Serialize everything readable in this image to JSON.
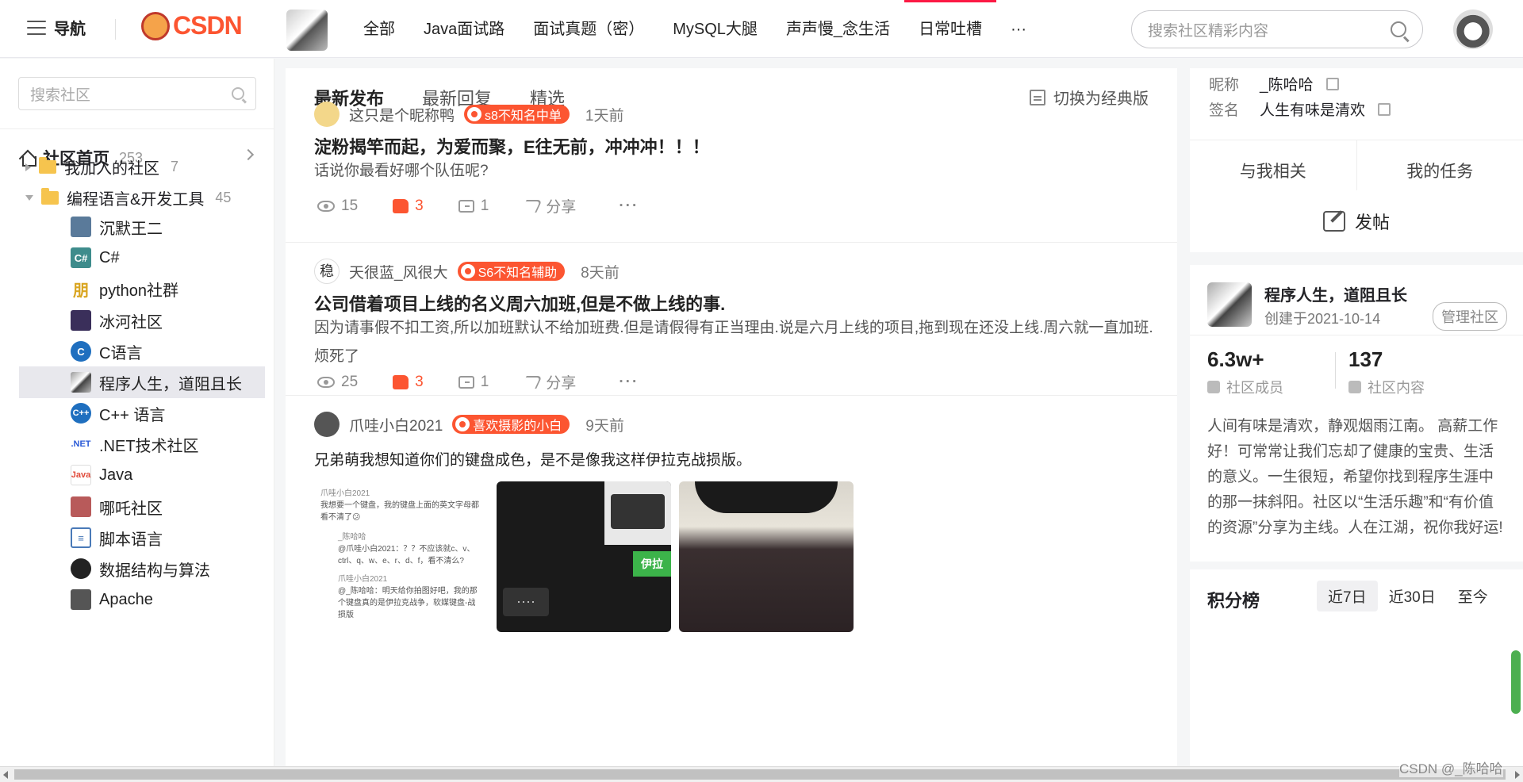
{
  "header": {
    "nav_label": "导航",
    "logo_text": "CSDN",
    "tabs": [
      {
        "label": "全部"
      },
      {
        "label": "Java面试路"
      },
      {
        "label": "面试真题（密）"
      },
      {
        "label": "MySQL大腿"
      },
      {
        "label": "声声慢_念生活"
      },
      {
        "label": "日常吐槽"
      },
      {
        "label": "···"
      }
    ],
    "active_tab": "日常吐槽",
    "search_placeholder": "搜索社区精彩内容"
  },
  "sidebar": {
    "search_placeholder": "搜索社区",
    "home": {
      "label": "社区首页",
      "count": "253"
    },
    "folders": [
      {
        "label": "我加入的社区",
        "count": "7"
      },
      {
        "label": "编程语言&开发工具",
        "count": "45"
      }
    ],
    "items": [
      {
        "label": "沉默王二",
        "icon": "user-photo-icon",
        "color": "#5a7a9a"
      },
      {
        "label": "C#",
        "icon": "csharp-icon",
        "color": "#3e8c8c"
      },
      {
        "label": "python社群",
        "icon": "python-char-icon",
        "color": "#d9a520"
      },
      {
        "label": "冰河社区",
        "icon": "user-photo-icon",
        "color": "#3a2f5a"
      },
      {
        "label": "C语言",
        "icon": "c-lang-icon",
        "color": "#1f6fbf"
      },
      {
        "label": "程序人生，道阻且长",
        "icon": "husky-icon",
        "color": "#777777"
      },
      {
        "label": "C++ 语言",
        "icon": "cpp-icon",
        "color": "#1f6fbf"
      },
      {
        "label": ".NET技术社区",
        "icon": "dotnet-icon",
        "color": "#2b5bd7"
      },
      {
        "label": "Java",
        "icon": "java-icon",
        "color": "#e8e8e8"
      },
      {
        "label": "哪吒社区",
        "icon": "user-photo-icon",
        "color": "#b85a5a"
      },
      {
        "label": "脚本语言",
        "icon": "script-icon",
        "color": "#4a7ab8"
      },
      {
        "label": "数据结构与算法",
        "icon": "user-photo-icon",
        "color": "#222222"
      },
      {
        "label": "Apache",
        "icon": "monitor-icon",
        "color": "#555555"
      }
    ],
    "active_item": "程序人生，道阻且长"
  },
  "main": {
    "tabs": [
      {
        "label": "最新发布"
      },
      {
        "label": "最新回复"
      },
      {
        "label": "精选"
      }
    ],
    "active_tab": "最新发布",
    "classic_label": "切换为经典版",
    "posts": [
      {
        "author": "这只是个昵称鸭",
        "badge": "s8不知名中单",
        "time": "1天前",
        "title": "淀粉揭竿而起，为爱而聚，E往无前，冲冲冲！！！",
        "body": "话说你最看好哪个队伍呢?",
        "views": "15",
        "likes": "3",
        "comments": "1",
        "share_label": "分享",
        "more": "···"
      },
      {
        "author": "天很蓝_风很大",
        "badge": "S6不知名辅助",
        "time": "8天前",
        "title": "公司借着项目上线的名义周六加班,但是不做上线的事.",
        "body": "因为请事假不扣工资,所以加班默认不给加班费.但是请假得有正当理由.说是六月上线的项目,拖到现在还没上线.周六就一直加班.烦死了",
        "views": "25",
        "likes": "3",
        "comments": "1",
        "share_label": "分享",
        "more": "···"
      },
      {
        "author": "爪哇小白2021",
        "badge": "喜欢摄影的小白",
        "time": "9天前",
        "body": "兄弟萌我想知道你们的键盘成色，是不是像我这样伊拉克战损版。"
      }
    ],
    "screenshot_lines": [
      "爪哇小白2021",
      "我想要一个键盘，我的键盘上面的英文字母都看不清了😕",
      "_陈哈哈",
      "@爪哇小白2021：？？不应该就c、v、ctrl、q、w、e、r、d、f，看不清么?",
      "爪哇小白2021",
      "@_陈哈哈：明天给你拍图好吧，我的那个键盘真的是伊拉克战争，软媒键盘-战损版"
    ],
    "overlay_label": "伊拉"
  },
  "right": {
    "nickname_label": "昵称",
    "nickname": "_陈哈哈",
    "signature_label": "签名",
    "signature": "人生有味是清欢",
    "tabs": [
      {
        "label": "与我相关"
      },
      {
        "label": "我的任务"
      }
    ],
    "post_button": "发帖",
    "community": {
      "name": "程序人生，道阻且长",
      "created": "创建于2021-10-14",
      "manage": "管理社区",
      "members": "6.3w+",
      "members_label": "社区成员",
      "content": "137",
      "content_label": "社区内容",
      "desc": "人间有味是清欢，静观烟雨江南。 高薪工作好！可常常让我们忘却了健康的宝贵、生活的意义。一生很短，希望你找到程序生涯中的那一抹斜阳。社区以“生活乐趣”和“有价值的资源”分享为主线。人在江湖，祝你我好运!"
    },
    "rank": {
      "title": "积分榜",
      "tabs": [
        {
          "label": "近7日"
        },
        {
          "label": "近30日"
        },
        {
          "label": "至今"
        }
      ],
      "active_tab": "近7日"
    }
  },
  "watermark": "CSDN @_陈哈哈",
  "colors": {
    "accent": "#fc5531",
    "active_tab_line": "#fc1944"
  }
}
